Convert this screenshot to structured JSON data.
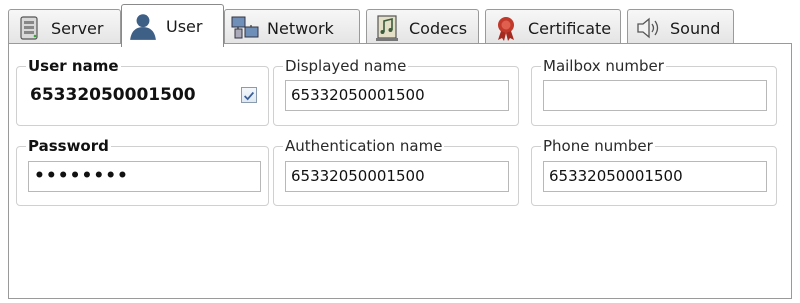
{
  "tabs": [
    {
      "label": "Server",
      "icon": "server-icon",
      "active": false
    },
    {
      "label": "User",
      "icon": "user-icon",
      "active": true
    },
    {
      "label": "Network",
      "icon": "network-icon",
      "active": false
    },
    {
      "label": "Codecs",
      "icon": "codecs-icon",
      "active": false
    },
    {
      "label": "Certificate",
      "icon": "certificate-icon",
      "active": false
    },
    {
      "label": "Sound",
      "icon": "sound-icon",
      "active": false
    }
  ],
  "user_name": {
    "label": "User name",
    "value": "65332050001500",
    "checked": true
  },
  "displayed_name": {
    "label": "Displayed name",
    "value": "65332050001500"
  },
  "mailbox_number": {
    "label": "Mailbox number",
    "value": ""
  },
  "password": {
    "label": "Password",
    "value": "••••••••"
  },
  "authentication_name": {
    "label": "Authentication name",
    "value": "65332050001500"
  },
  "phone_number": {
    "label": "Phone number",
    "value": "65332050001500"
  },
  "colors": {
    "checkbox_tick": "#3a5f9a",
    "user_icon": "#3e5f86"
  }
}
